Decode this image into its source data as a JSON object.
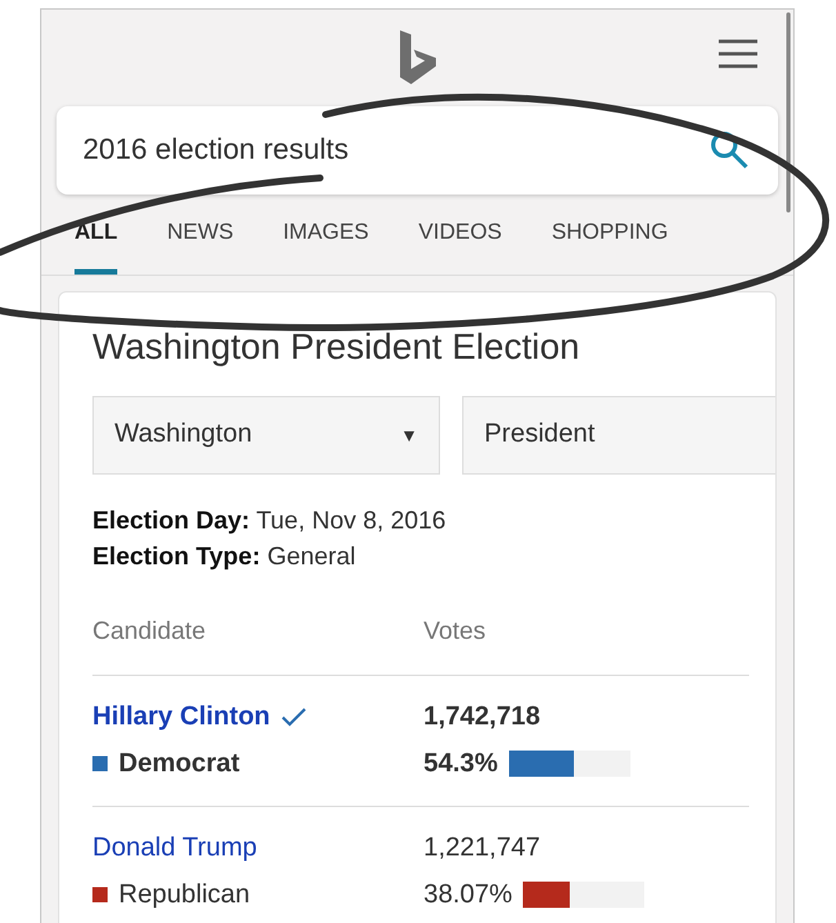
{
  "search": {
    "value": "2016 election results"
  },
  "tabs": [
    {
      "label": "ALL",
      "selected": true
    },
    {
      "label": "NEWS",
      "selected": false
    },
    {
      "label": "IMAGES",
      "selected": false
    },
    {
      "label": "VIDEOS",
      "selected": false
    },
    {
      "label": "SHOPPING",
      "selected": false
    }
  ],
  "card": {
    "title": "Washington President Election",
    "dropdowns": [
      {
        "value": "Washington",
        "caret": "▼"
      },
      {
        "value": "President"
      }
    ],
    "facts": [
      {
        "label": "Election Day:",
        "value": "Tue, Nov 8, 2016"
      },
      {
        "label": "Election Type:",
        "value": "General"
      }
    ],
    "columns": [
      "Candidate",
      "Votes"
    ],
    "candidates": [
      {
        "name": "Hillary Clinton",
        "winner": true,
        "party": "Democrat",
        "color": "#2a6db0",
        "votes": "1,742,718",
        "percent": "54.3%",
        "level": 0.54
      },
      {
        "name": "Donald Trump",
        "winner": false,
        "party": "Republican",
        "color": "#b52a1c",
        "votes": "1,221,747",
        "percent": "38.07%",
        "level": 0.38
      }
    ]
  }
}
